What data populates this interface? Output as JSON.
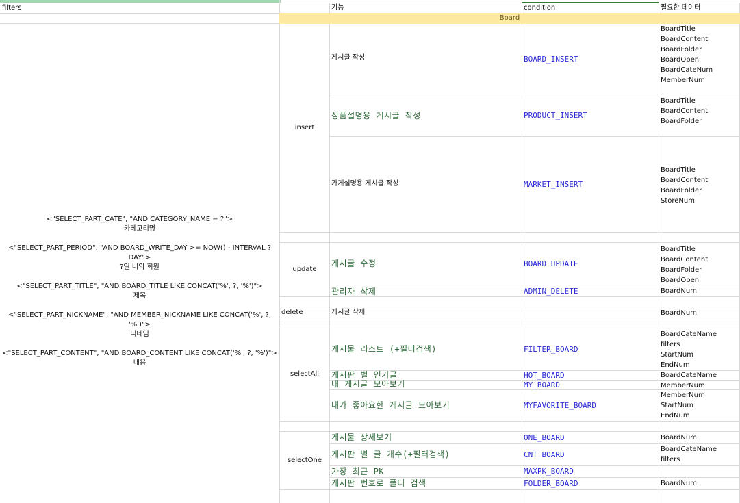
{
  "header": {
    "filters": "filters",
    "feature": "기능",
    "condition": "condition",
    "required_data": "필요한 데이터"
  },
  "band": {
    "label": "Board"
  },
  "filters_left": [
    {
      "code": "<\"SELECT_PART_CATE\", \"AND CATEGORY_NAME = ?\">",
      "label": "카테고리명"
    },
    {
      "code": "<\"SELECT_PART_PERIOD\", \"AND BOARD_WRITE_DAY >= NOW() - INTERVAL ? DAY\">",
      "label": "?일 내의 회원"
    },
    {
      "code": "<\"SELECT_PART_TITLE\", \"AND BOARD_TITLE LIKE CONCAT('%', ?, '%')\">",
      "label": "제목"
    },
    {
      "code": "<\"SELECT_PART_NICKNAME\", \"AND MEMBER_NICKNAME LIKE CONCAT('%', ?, '%')\">",
      "label": "닉네임"
    },
    {
      "code": "<\"SELECT_PART_CONTENT\", \"AND BOARD_CONTENT LIKE CONCAT('%', ?, '%')\">",
      "label": "내용"
    }
  ],
  "groups": {
    "insert": "insert",
    "update": "update",
    "delete": "delete",
    "selectAll": "selectAll",
    "selectOne": "selectOne"
  },
  "rows": [
    {
      "feature": "게시글 작성",
      "condition": "BOARD_INSERT",
      "data": [
        "BoardTitle",
        "BoardContent",
        "BoardFolder",
        "BoardOpen",
        "BoardCateNum",
        "MemberNum"
      ]
    },
    {
      "feature": "상품설명용 게시글 작성",
      "condition": "PRODUCT_INSERT",
      "data": [
        "BoardTitle",
        "BoardContent",
        "BoardFolder"
      ]
    },
    {
      "feature": "가게설명용 게시글 작성",
      "condition": "MARKET_INSERT",
      "data": [
        "BoardTitle",
        "BoardContent",
        "BoardFolder",
        "StoreNum"
      ]
    },
    {
      "feature": "게시글 수정",
      "condition": "BOARD_UPDATE",
      "data": [
        "BoardTitle",
        "BoardContent",
        "BoardFolder",
        "BoardOpen"
      ]
    },
    {
      "feature": "관리자 삭제",
      "condition": "ADMIN_DELETE",
      "data": [
        "BoardNum"
      ]
    },
    {
      "feature": "게시글 삭제",
      "condition": "",
      "data": [
        "BoardNum"
      ]
    },
    {
      "feature": "게시물 리스트 (+필터검색)",
      "condition": "FILTER_BOARD",
      "data": [
        "BoardCateName",
        "filters",
        "StartNum",
        "EndNum"
      ]
    },
    {
      "feature": "게시판 별 인기글",
      "condition": "HOT_BOARD",
      "data": [
        "BoardCateName"
      ]
    },
    {
      "feature": "내 게시글 모아보기",
      "condition": "MY_BOARD",
      "data": [
        "MemberNum"
      ]
    },
    {
      "feature": "내가 좋아요한 게시글 모아보기",
      "condition": "MYFAVORITE_BOARD",
      "data": [
        "MemberNum",
        "StartNum",
        "EndNum"
      ]
    },
    {
      "feature": "게시물 상세보기",
      "condition": "ONE_BOARD",
      "data": [
        "BoardNum"
      ]
    },
    {
      "feature": "게시판 별 글 개수(+필터검색)",
      "condition": "CNT_BOARD",
      "data": [
        "BoardCateName",
        "filters"
      ]
    },
    {
      "feature": "가장 최근 PK",
      "condition": "MAXPK_BOARD",
      "data": []
    },
    {
      "feature": "게시판 번호로 폴더 검색",
      "condition": "FOLDER_BOARD",
      "data": [
        "BoardNum"
      ]
    }
  ]
}
